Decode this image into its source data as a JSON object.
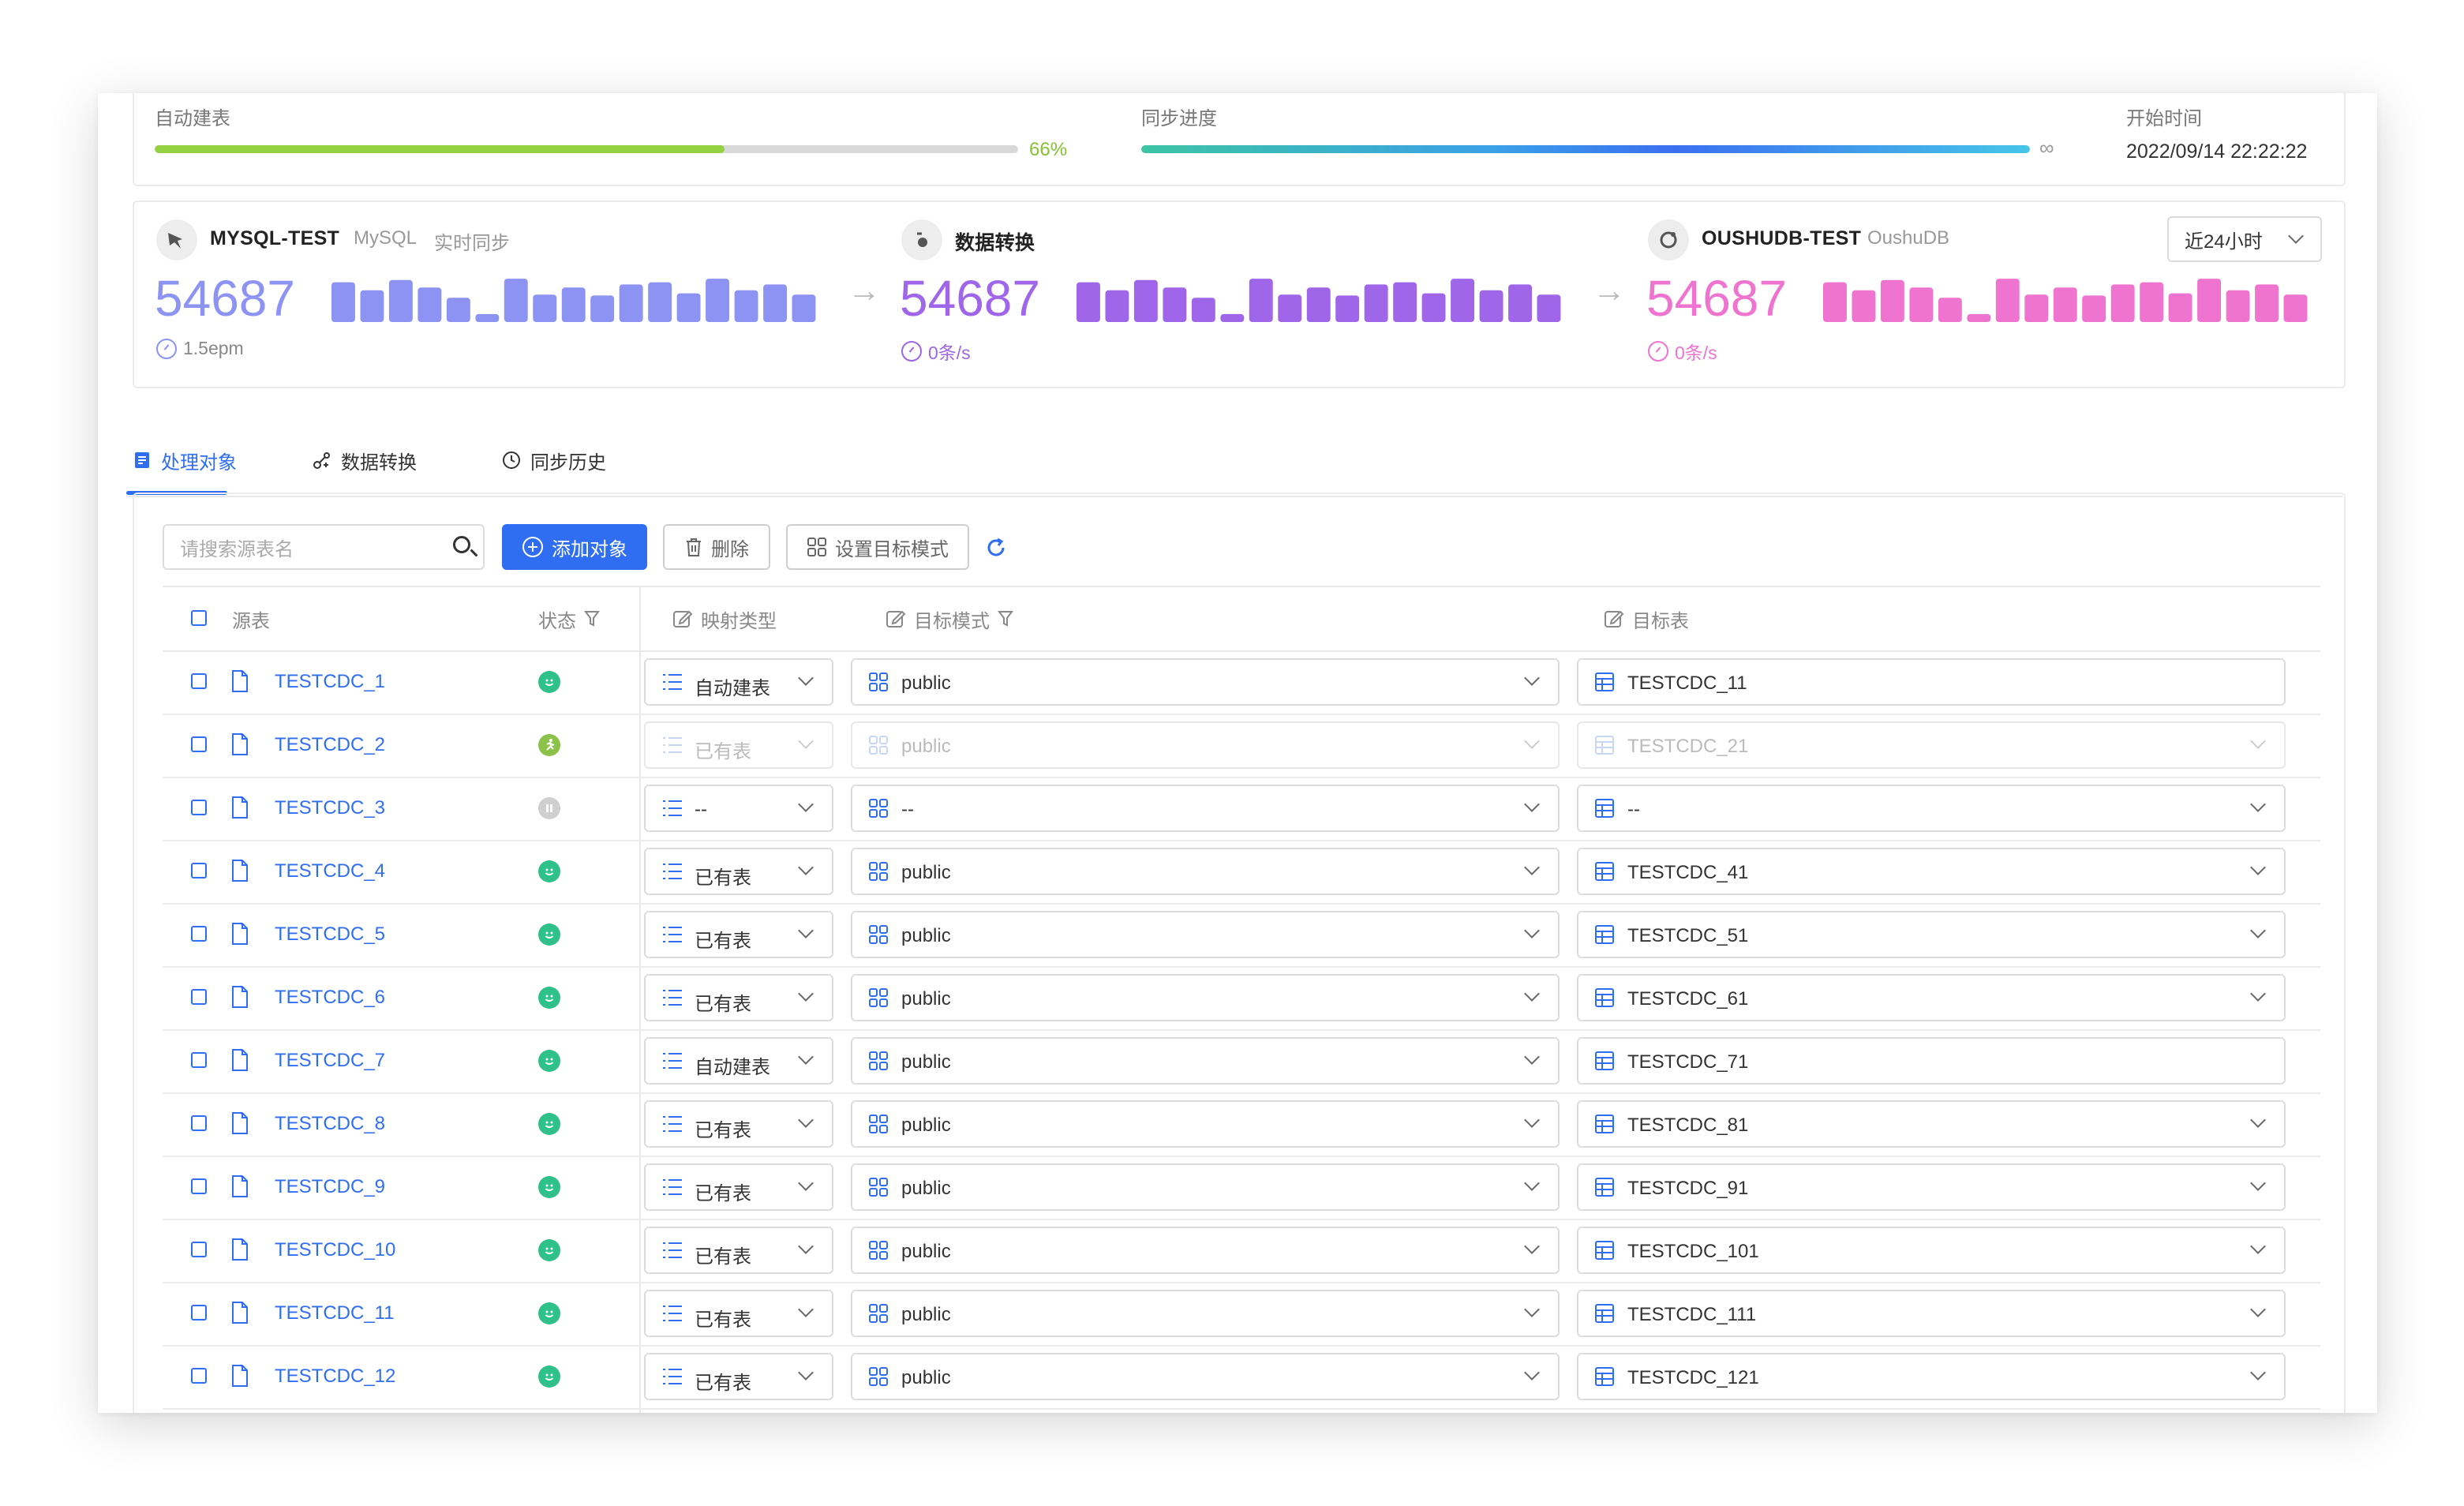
{
  "progress": {
    "auto_create": {
      "label": "自动建表",
      "percent_text": "66%",
      "value": 0.66,
      "color": "#93d042"
    },
    "sync": {
      "label": "同步进度",
      "end_text": "∞"
    },
    "start": {
      "label": "开始时间",
      "value": "2022/09/14 22:22:22"
    }
  },
  "pipeline": {
    "source": {
      "name": "MYSQL-TEST",
      "type": "MySQL",
      "mode": "实时同步",
      "count": "54687",
      "rate": "1.5epm",
      "color": "#8c93f2",
      "icon": "mysql-dolphin-icon"
    },
    "transform": {
      "name": "数据转换",
      "count": "54687",
      "rate": "0条/s",
      "color": "#9f66ea",
      "icon": "transform-icon"
    },
    "target": {
      "name": "OUSHUDB-TEST",
      "type": "OushuDB",
      "count": "54687",
      "rate": "0条/s",
      "color": "#ef74d0",
      "icon": "oushudb-icon"
    },
    "arrow": "→",
    "range": "近24小时",
    "sparkline": [
      0.9,
      0.72,
      0.95,
      0.78,
      0.55,
      0.18,
      0.98,
      0.62,
      0.78,
      0.6,
      0.85,
      0.9,
      0.65,
      0.98,
      0.72,
      0.85,
      0.62
    ]
  },
  "tabs": [
    {
      "label": "处理对象",
      "icon": "document-icon",
      "active": true
    },
    {
      "label": "数据转换",
      "icon": "transform-icon",
      "active": false
    },
    {
      "label": "同步历史",
      "icon": "clock-icon",
      "active": false
    }
  ],
  "toolbar": {
    "search_placeholder": "请搜索源表名",
    "add": "添加对象",
    "delete": "删除",
    "set_target": "设置目标模式"
  },
  "table": {
    "headers": {
      "source": "源表",
      "status": "状态",
      "map_type": "映射类型",
      "target_schema": "目标模式",
      "target_table": "目标表"
    },
    "rows": [
      {
        "source": "TESTCDC_1",
        "status": "ok",
        "map": "自动建表",
        "schema": "public",
        "target": "TESTCDC_11",
        "disabled": false,
        "target_dropdown": false
      },
      {
        "source": "TESTCDC_2",
        "status": "running",
        "map": "已有表",
        "schema": "public",
        "target": "TESTCDC_21",
        "disabled": true,
        "target_dropdown": true
      },
      {
        "source": "TESTCDC_3",
        "status": "pending",
        "map": "--",
        "schema": "--",
        "target": "--",
        "disabled": false,
        "target_dropdown": true
      },
      {
        "source": "TESTCDC_4",
        "status": "ok",
        "map": "已有表",
        "schema": "public",
        "target": "TESTCDC_41",
        "disabled": false,
        "target_dropdown": true
      },
      {
        "source": "TESTCDC_5",
        "status": "ok",
        "map": "已有表",
        "schema": "public",
        "target": "TESTCDC_51",
        "disabled": false,
        "target_dropdown": true
      },
      {
        "source": "TESTCDC_6",
        "status": "ok",
        "map": "已有表",
        "schema": "public",
        "target": "TESTCDC_61",
        "disabled": false,
        "target_dropdown": true
      },
      {
        "source": "TESTCDC_7",
        "status": "ok",
        "map": "自动建表",
        "schema": "public",
        "target": "TESTCDC_71",
        "disabled": false,
        "target_dropdown": false
      },
      {
        "source": "TESTCDC_8",
        "status": "ok",
        "map": "已有表",
        "schema": "public",
        "target": "TESTCDC_81",
        "disabled": false,
        "target_dropdown": true
      },
      {
        "source": "TESTCDC_9",
        "status": "ok",
        "map": "已有表",
        "schema": "public",
        "target": "TESTCDC_91",
        "disabled": false,
        "target_dropdown": true
      },
      {
        "source": "TESTCDC_10",
        "status": "ok",
        "map": "已有表",
        "schema": "public",
        "target": "TESTCDC_101",
        "disabled": false,
        "target_dropdown": true
      },
      {
        "source": "TESTCDC_11",
        "status": "ok",
        "map": "已有表",
        "schema": "public",
        "target": "TESTCDC_111",
        "disabled": false,
        "target_dropdown": true
      },
      {
        "source": "TESTCDC_12",
        "status": "ok",
        "map": "已有表",
        "schema": "public",
        "target": "TESTCDC_121",
        "disabled": false,
        "target_dropdown": true
      }
    ]
  },
  "colors": {
    "accent": "#2f6ef2",
    "status_ok": "#2ec18a",
    "status_running": "#8bc34a",
    "status_pending": "#cfcfcf"
  }
}
